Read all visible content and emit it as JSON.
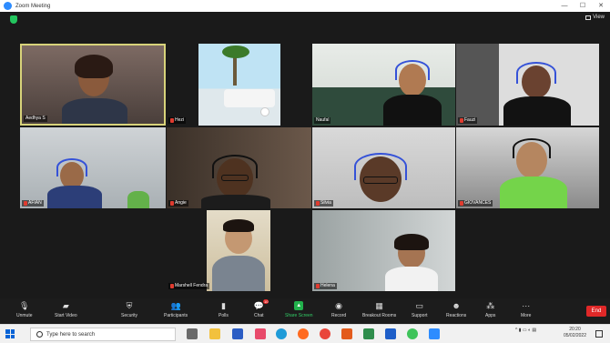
{
  "window": {
    "title": "Zoom Meeting",
    "controls": [
      "—",
      "☐",
      "✕"
    ]
  },
  "view_label": "View",
  "participants": [
    {
      "name": "Aedhya S"
    },
    {
      "name": "Hezi"
    },
    {
      "name": "Naufal"
    },
    {
      "name": "Fauzi"
    },
    {
      "name": "AFIAN"
    },
    {
      "name": "Angie"
    },
    {
      "name": "Silvia"
    },
    {
      "name": "GIOVANCES"
    },
    {
      "name": "Marshell Fendra"
    },
    {
      "name": "Helena"
    }
  ],
  "toolbar": {
    "items": [
      {
        "label": "Unmute",
        "icon": "microphone-muted-icon"
      },
      {
        "label": "Start Video",
        "icon": "video-off-icon"
      },
      {
        "label": "Security",
        "icon": "shield-icon"
      },
      {
        "label": "Participants",
        "icon": "participants-icon",
        "count": "10"
      },
      {
        "label": "Polls",
        "icon": "polls-icon"
      },
      {
        "label": "Chat",
        "icon": "chat-icon",
        "badge": "10"
      },
      {
        "label": "Share Screen",
        "icon": "share-screen-icon"
      },
      {
        "label": "Record",
        "icon": "record-icon"
      },
      {
        "label": "Breakout Rooms",
        "icon": "breakout-rooms-icon"
      },
      {
        "label": "Support",
        "icon": "support-icon"
      },
      {
        "label": "Reactions",
        "icon": "reactions-icon"
      },
      {
        "label": "Apps",
        "icon": "apps-icon"
      },
      {
        "label": "More",
        "icon": "more-icon"
      }
    ],
    "end_label": "End",
    "active_color": "#22b14c",
    "end_color": "#e02828"
  },
  "taskbar": {
    "search_placeholder": "Type here to search",
    "time": "20:20",
    "date": "05/02/2022"
  }
}
